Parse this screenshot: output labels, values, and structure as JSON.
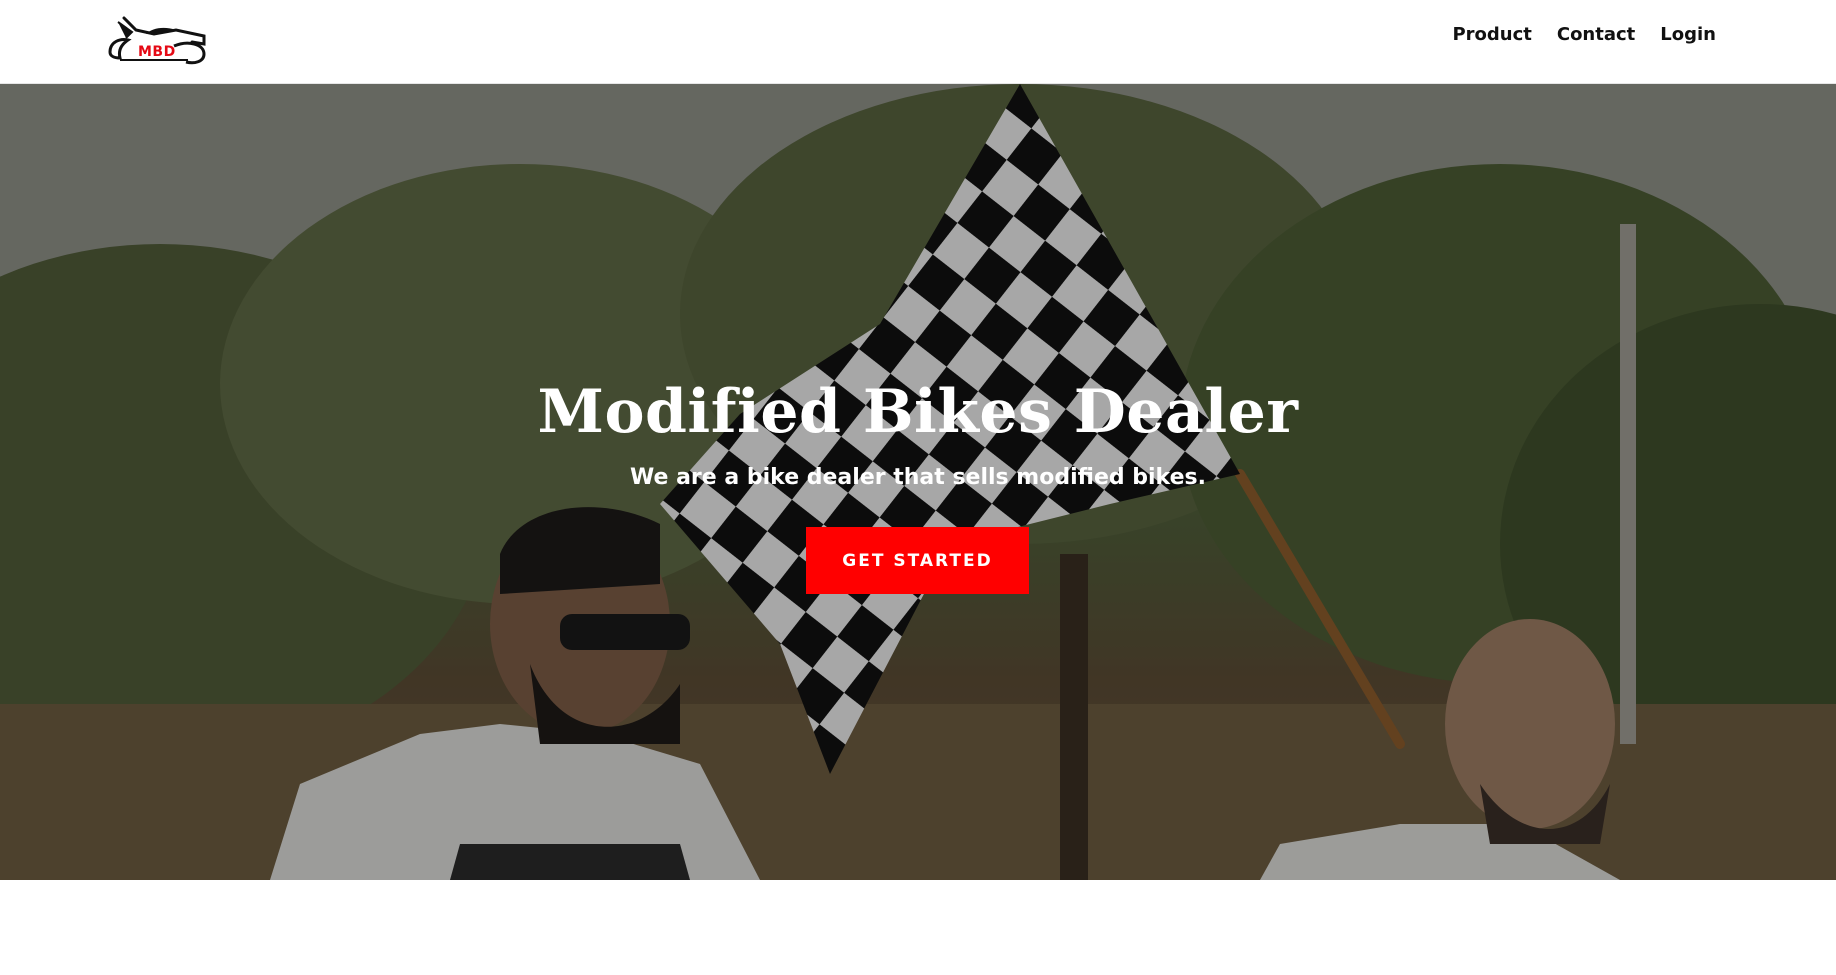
{
  "brand": {
    "logo_text": "MBD",
    "accent_color": "#e50914"
  },
  "nav": {
    "items": [
      {
        "label": "Product"
      },
      {
        "label": "Contact"
      },
      {
        "label": "Login"
      }
    ]
  },
  "hero": {
    "title": "Modified Bikes Dealer",
    "subtitle": "We are a bike dealer that sells modified bikes.",
    "cta_label": "GET STARTED",
    "cta_color": "#ff0000"
  }
}
